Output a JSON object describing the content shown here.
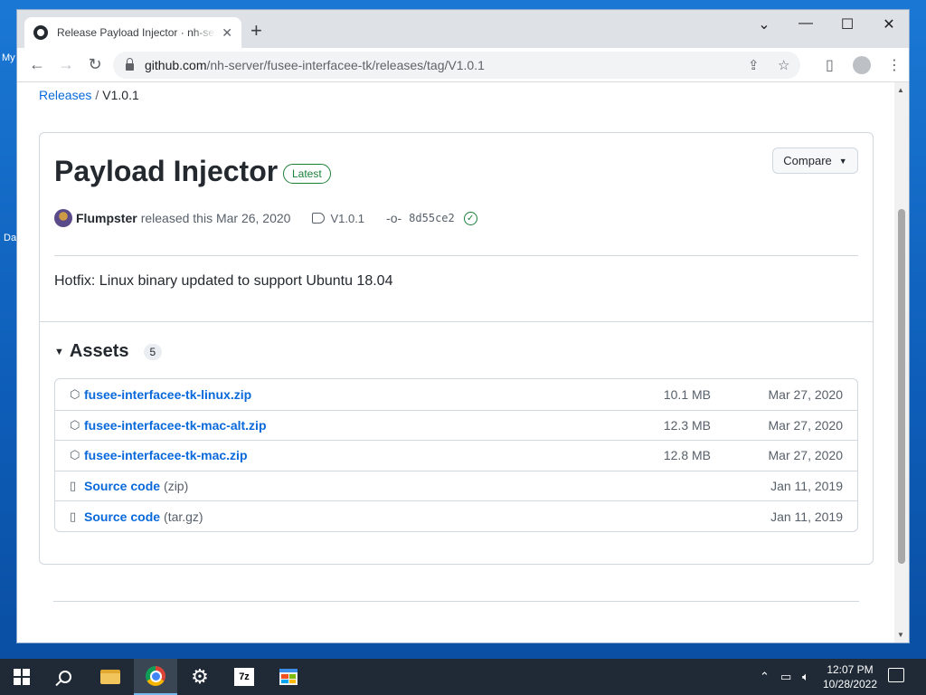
{
  "desktop": {
    "icon_label_1": "My",
    "icon_label_2": "Da"
  },
  "browser": {
    "tab_title": "Release Payload Injector · nh-server",
    "tab_close": "✕",
    "new_tab": "+",
    "url_host": "github.com",
    "url_path": "/nh-server/fusee-interfacee-tk/releases/tag/V1.0.1",
    "window_controls": {
      "chevron": "⌄",
      "minimize": "—",
      "maximize": "☐",
      "close": "✕"
    }
  },
  "breadcrumb": {
    "parent": "Releases",
    "separator": "/",
    "current": "V1.0.1"
  },
  "release": {
    "title": "Payload Injector",
    "badge": "Latest",
    "compare_label": "Compare",
    "author": "Flumpster",
    "released_text": "released this Mar 26, 2020",
    "tag": "V1.0.1",
    "commit": "8d55ce2",
    "notes": "Hotfix: Linux binary updated to support Ubuntu 18.04"
  },
  "assets": {
    "title": "Assets",
    "count": "5",
    "items": [
      {
        "name": "fusee-interfacee-tk-linux.zip",
        "sub": "",
        "size": "10.1 MB",
        "date": "Mar 27, 2020",
        "icon": "package-icon"
      },
      {
        "name": "fusee-interfacee-tk-mac-alt.zip",
        "sub": "",
        "size": "12.3 MB",
        "date": "Mar 27, 2020",
        "icon": "package-icon"
      },
      {
        "name": "fusee-interfacee-tk-mac.zip",
        "sub": "",
        "size": "12.8 MB",
        "date": "Mar 27, 2020",
        "icon": "package-icon"
      },
      {
        "name": "Source code",
        "sub": "(zip)",
        "size": "",
        "date": "Jan 11, 2019",
        "icon": "file-zip-icon"
      },
      {
        "name": "Source code",
        "sub": "(tar.gz)",
        "size": "",
        "date": "Jan 11, 2019",
        "icon": "file-zip-icon"
      }
    ]
  },
  "taskbar": {
    "time": "12:07 PM",
    "date": "10/28/2022",
    "app_7z": "7z"
  },
  "colors": {
    "link": "#0969da",
    "latest_green": "#1a7f37",
    "taskbar": "#1f2a36"
  }
}
